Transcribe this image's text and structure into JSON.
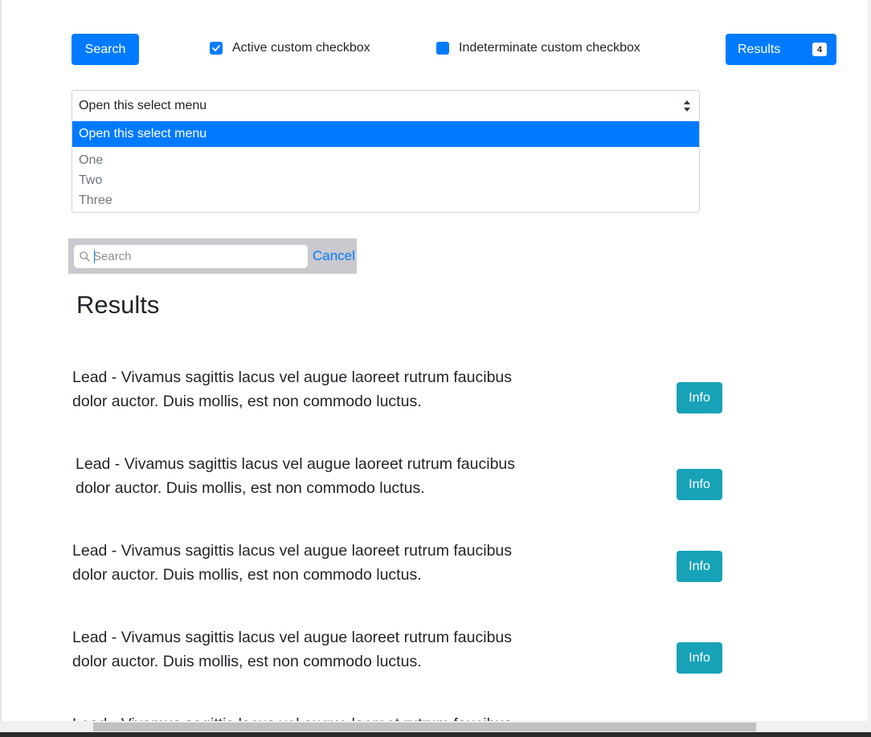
{
  "toolbar": {
    "search_label": "Search",
    "active_checkbox_label": "Active custom checkbox",
    "indeterminate_checkbox_label": "Indeterminate custom checkbox",
    "results_label": "Results",
    "results_count": "4"
  },
  "select": {
    "current": "Open this select menu",
    "options": [
      "Open this select menu",
      "One",
      "Two",
      "Three"
    ]
  },
  "searchbar": {
    "placeholder": "Search",
    "cancel_label": "Cancel"
  },
  "results": {
    "heading": "Results",
    "items": [
      {
        "text": "Lead - Vivamus sagittis lacus vel augue laoreet rutrum faucibus dolor auctor. Duis mollis, est non commodo luctus.",
        "button": "Info"
      },
      {
        "text": "Lead - Vivamus sagittis lacus vel augue laoreet rutrum faucibus dolor auctor. Duis mollis, est non commodo luctus.",
        "button": "Info"
      },
      {
        "text": "Lead - Vivamus sagittis lacus vel augue laoreet rutrum faucibus dolor auctor. Duis mollis, est non commodo luctus.",
        "button": "Info"
      },
      {
        "text": "Lead - Vivamus sagittis lacus vel augue laoreet rutrum faucibus dolor auctor. Duis mollis, est non commodo luctus.",
        "button": "Info"
      },
      {
        "text": "Lead - Vivamus sagittis lacus vel augue laoreet rutrum faucibus",
        "button": ""
      }
    ]
  },
  "colors": {
    "primary": "#007bff",
    "info": "#17a2b8",
    "ios_blue": "#007aff",
    "searchbar_bg": "#c9c9ce"
  },
  "icons": {
    "checkmark": "check-icon",
    "select_arrows": "sort-arrows-icon",
    "magnifier": "search-icon"
  }
}
